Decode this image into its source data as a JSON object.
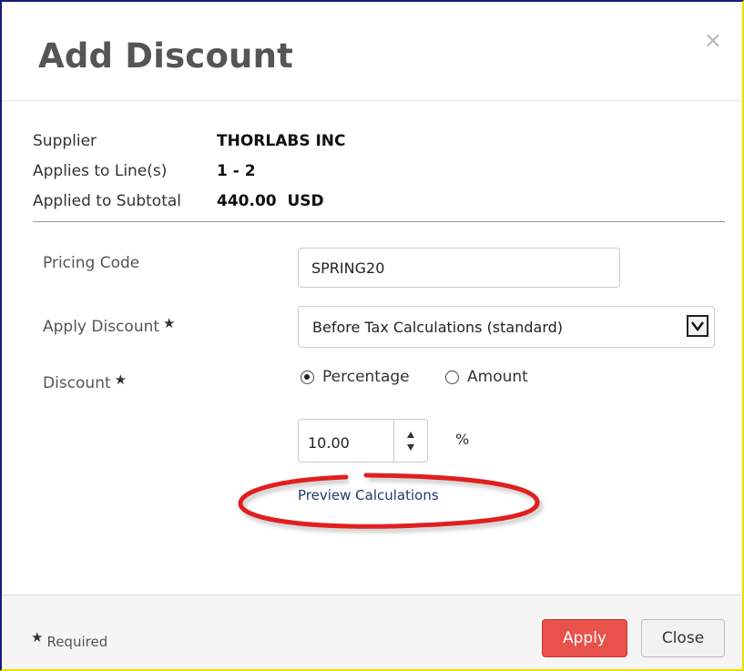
{
  "dialog": {
    "title": "Add Discount",
    "close_glyph": "×"
  },
  "info": {
    "supplier_label": "Supplier",
    "supplier_value": "THORLABS INC",
    "lines_label": "Applies to Line(s)",
    "lines_value": "1 - 2",
    "subtotal_label": "Applied to Subtotal",
    "subtotal_value": "440.00  USD"
  },
  "form": {
    "required_star": "★",
    "pricing_code": {
      "label": "Pricing Code",
      "value": "SPRING20"
    },
    "apply_discount": {
      "label": "Apply Discount",
      "selected": "Before Tax Calculations (standard)"
    },
    "discount": {
      "label": "Discount",
      "options": [
        {
          "label": "Percentage",
          "checked": true
        },
        {
          "label": "Amount",
          "checked": false
        }
      ],
      "value": "10.00",
      "unit": "%"
    },
    "preview_link": "Preview Calculations"
  },
  "footer": {
    "required_note": "Required",
    "apply_label": "Apply",
    "close_label": "Close"
  },
  "colors": {
    "apply_button": "#e8524a",
    "annotation_ellipse": "#e02020",
    "link": "#1f3a6e"
  }
}
